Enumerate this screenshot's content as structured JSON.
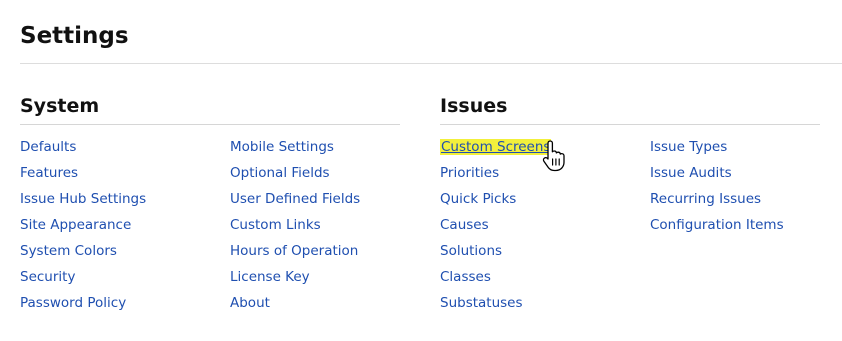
{
  "page": {
    "title": "Settings"
  },
  "system": {
    "heading": "System",
    "column1": [
      "Defaults",
      "Features",
      "Issue Hub Settings",
      "Site Appearance",
      "System Colors",
      "Security",
      "Password Policy"
    ],
    "column2": [
      "Mobile Settings",
      "Optional Fields",
      "User Defined Fields",
      "Custom Links",
      "Hours of Operation",
      "License Key",
      "About"
    ]
  },
  "issues": {
    "heading": "Issues",
    "column1": [
      "Custom Screens",
      "Priorities",
      "Quick Picks",
      "Causes",
      "Solutions",
      "Classes",
      "Substatuses"
    ],
    "column2": [
      "Issue Types",
      "Issue Audits",
      "Recurring Issues",
      "Configuration Items"
    ]
  },
  "state": {
    "hovered_link": "Custom Screens",
    "hover_highlight_color": "#f2f03c",
    "link_color": "#1f4fb0",
    "cursor_icon": "hand-pointer-icon"
  }
}
